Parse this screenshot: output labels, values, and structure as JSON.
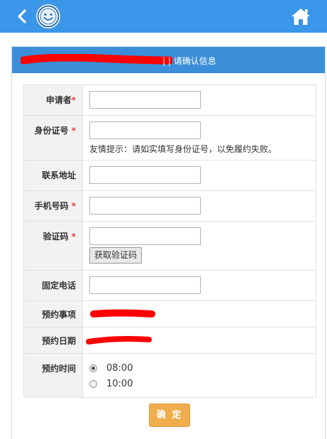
{
  "header": {
    "back_icon": "chevron-left-icon",
    "logo_icon": "smiley-logo-icon",
    "home_icon": "home-icon",
    "bar_color": "#3a96e8"
  },
  "panel": {
    "title_label": "| | 请确认信息",
    "head_color": "#3a8fd8"
  },
  "form": {
    "applicant": {
      "label": "申请者",
      "required_mark": "*",
      "value": ""
    },
    "id_number": {
      "label": "身份证号",
      "required_mark": "*",
      "value": "",
      "hint": "友情提示：请如实填写身份证号，以免履约失败。"
    },
    "address": {
      "label": "联系地址",
      "value": ""
    },
    "mobile": {
      "label": "手机号码",
      "required_mark": "*",
      "value": ""
    },
    "verify_code": {
      "label": "验证码",
      "required_mark": "*",
      "value": "",
      "button_label": "获取验证码"
    },
    "landline": {
      "label": "固定电话",
      "value": ""
    },
    "appointment_item": {
      "label": "预约事项"
    },
    "appointment_date": {
      "label": "预约日期"
    },
    "appointment_time": {
      "label": "预约时间",
      "options": [
        {
          "label": "08:00",
          "selected": true
        },
        {
          "label": "10:00",
          "selected": false
        }
      ]
    }
  },
  "confirm_label": "确 定",
  "colors": {
    "required": "#e23b3b",
    "confirm": "#f0ad4e",
    "redaction": "#ff0000"
  }
}
